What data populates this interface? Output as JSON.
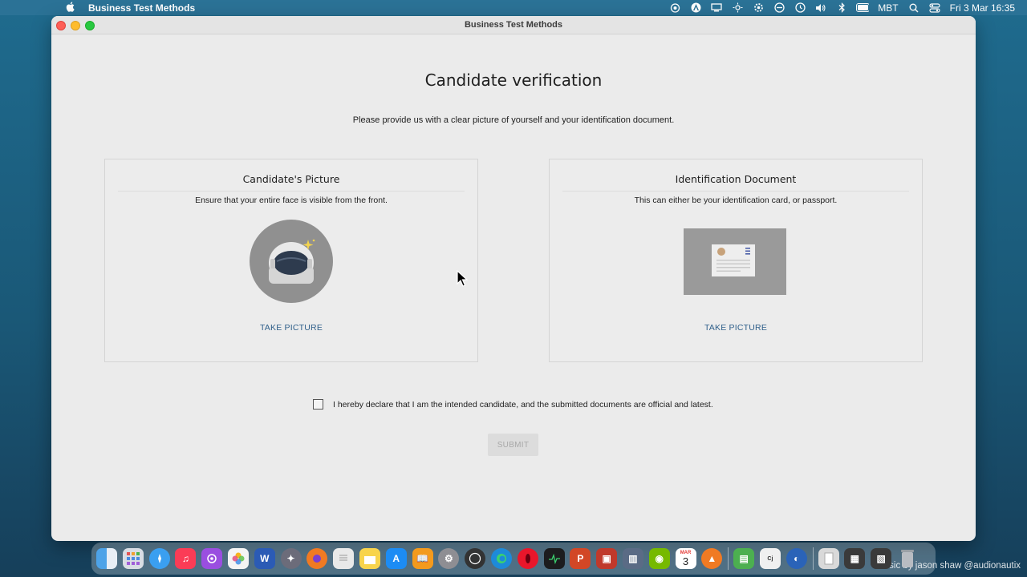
{
  "menubar": {
    "app_name": "Business Test Methods",
    "keyboard_layout": "MBT",
    "datetime": "Fri 3 Mar  16:35"
  },
  "window": {
    "title": "Business Test Methods"
  },
  "page": {
    "title": "Candidate verification",
    "subtitle": "Please provide us with a clear picture of yourself and your identification document."
  },
  "cards": {
    "picture": {
      "title": "Candidate's Picture",
      "description": "Ensure that your entire face is visible from the front.",
      "action": "TAKE PICTURE"
    },
    "document": {
      "title": "Identification Document",
      "description": "This can either be your identification card, or passport.",
      "action": "TAKE PICTURE"
    }
  },
  "declaration": {
    "checked": false,
    "text": "I hereby declare that I am the intended candidate, and the submitted documents are official and latest."
  },
  "submit": {
    "label": "SUBMIT",
    "enabled": false
  },
  "watermark": "music by jason shaw @audionautix",
  "dock": {
    "calendar_month": "MAR",
    "calendar_day": "3",
    "apps": [
      "finder-icon",
      "launchpad-icon",
      "safari-icon",
      "music-icon",
      "podcasts-icon",
      "photos-icon",
      "word-icon",
      "dock-app-icon",
      "firefox-icon",
      "textedit-icon",
      "notes-icon",
      "app-store-icon",
      "books-icon",
      "system-preferences-icon",
      "obs-icon",
      "edge-icon",
      "opera-icon",
      "activity-monitor-icon",
      "powerpoint-icon",
      "dock-app-icon",
      "dock-app-icon",
      "nvidia-icon",
      "calendar-icon",
      "dock-app-icon",
      "spreeder-icon",
      "conjugation-icon",
      "dictionary-icon",
      "document-icon",
      "dock-app-icon",
      "dock-app-icon",
      "trash-icon"
    ]
  },
  "colors": {
    "link": "#2f5f8a",
    "window_bg": "#ebebeb",
    "desktop": "#1f6b8e"
  }
}
